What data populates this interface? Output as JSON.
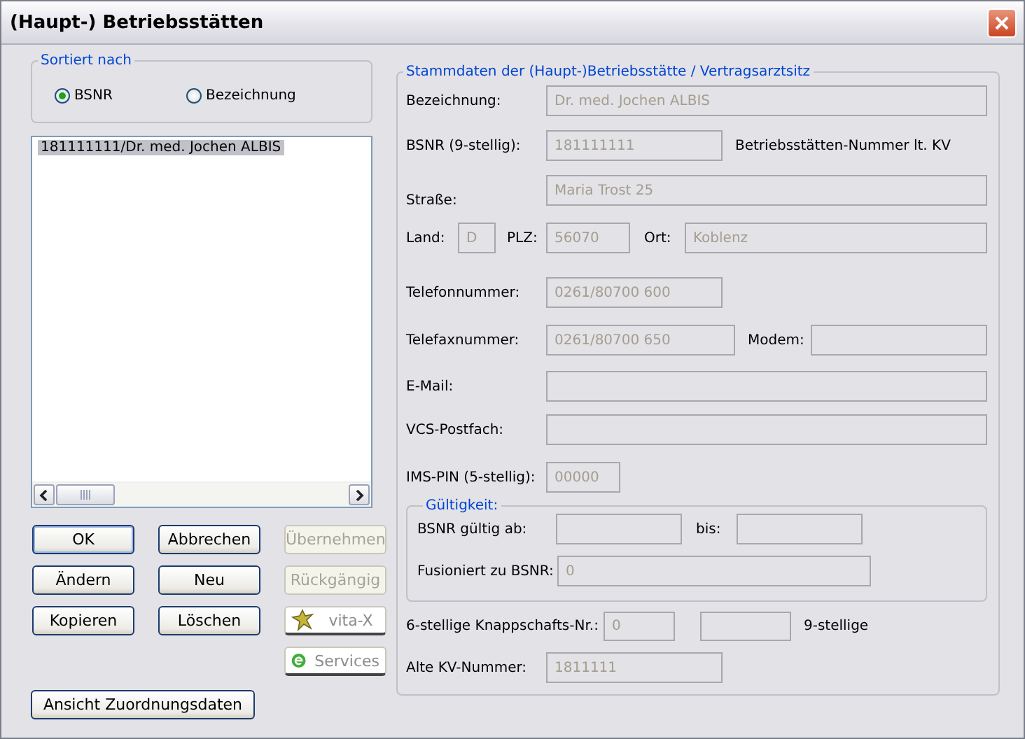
{
  "window": {
    "title": "(Haupt-) Betriebsstätten"
  },
  "sort": {
    "legend": "Sortiert nach",
    "options": [
      {
        "label": "BSNR",
        "selected": true
      },
      {
        "label": "Bezeichnung",
        "selected": false
      }
    ]
  },
  "list": {
    "items": [
      {
        "text": "181111111/Dr. med. Jochen ALBIS",
        "selected": true
      }
    ]
  },
  "buttons": [
    {
      "label": "OK",
      "kind": "standard",
      "disabled": false,
      "default": true
    },
    {
      "label": "Abbrechen",
      "kind": "standard",
      "disabled": false,
      "default": false
    },
    {
      "label": "Übernehmen",
      "kind": "standard",
      "disabled": true,
      "default": false
    },
    {
      "label": "Ändern",
      "kind": "standard",
      "disabled": false,
      "default": false
    },
    {
      "label": "Neu",
      "kind": "standard",
      "disabled": false,
      "default": false
    },
    {
      "label": "Rückgängig",
      "kind": "standard",
      "disabled": true,
      "default": false
    },
    {
      "label": "Kopieren",
      "kind": "standard",
      "disabled": false,
      "default": false
    },
    {
      "label": "Löschen",
      "kind": "standard",
      "disabled": false,
      "default": false
    },
    {
      "label": "vita-X",
      "kind": "app",
      "disabled": false,
      "default": false
    },
    {
      "label": "Services",
      "kind": "app",
      "disabled": false,
      "default": false
    }
  ],
  "view_button": {
    "label": "Ansicht Zuordnungsdaten"
  },
  "form": {
    "legend": "Stammdaten der (Haupt-)Betriebsstätte / Vertragsarztsitz",
    "bezeichnung": {
      "label": "Bezeichnung:",
      "value": "Dr. med. Jochen ALBIS"
    },
    "bsnr": {
      "label": "BSNR (9-stellig):",
      "value": "181111111",
      "note": "Betriebsstätten-Nummer lt. KV"
    },
    "strasse": {
      "label": "Straße:",
      "value": "Maria Trost 25"
    },
    "land": {
      "label": "Land:",
      "value": "D"
    },
    "plz": {
      "label": "PLZ:",
      "value": "56070"
    },
    "ort": {
      "label": "Ort:",
      "value": "Koblenz"
    },
    "telefon": {
      "label": "Telefonnummer:",
      "value": "0261/80700 600"
    },
    "telefax": {
      "label": "Telefaxnummer:",
      "value": "0261/80700 650"
    },
    "modem": {
      "label": "Modem:"
    },
    "email": {
      "label": "E-Mail:"
    },
    "vcs": {
      "label": "VCS-Postfach:"
    },
    "ims": {
      "label": "IMS-PIN (5-stellig):",
      "value": "00000"
    },
    "validity": {
      "legend": "Gültigkeit:",
      "from": {
        "label": "BSNR gültig ab:"
      },
      "to": {
        "label": "bis:"
      },
      "merged": {
        "label": "Fusioniert zu BSNR:",
        "value": "0"
      }
    },
    "knappschaft": {
      "label": "6-stellige Knappschafts-Nr.:",
      "value": "0",
      "label_9": "9-stellige"
    },
    "alte_kv": {
      "label": "Alte KV-Nummer:",
      "value": "1811111"
    }
  }
}
